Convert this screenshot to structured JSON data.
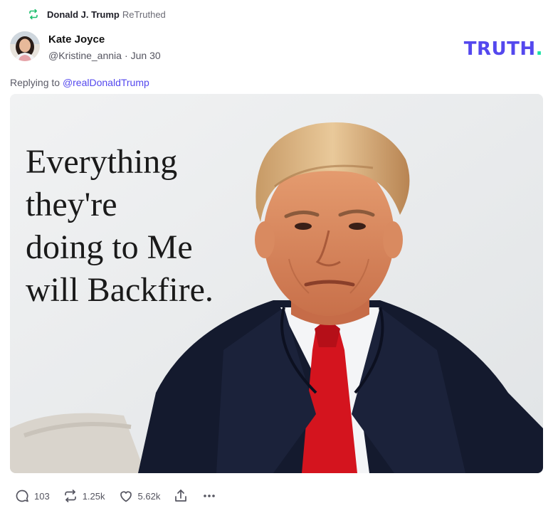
{
  "retruth": {
    "user": "Donald J. Trump",
    "label": "ReTruthed"
  },
  "author": {
    "name": "Kate Joyce",
    "handle": "@Kristine_annia",
    "date": "Jun 30"
  },
  "logo": {
    "text": "TRUTH",
    "dot": "."
  },
  "reply": {
    "prefix": "Replying to",
    "handle": "@realDonaldTrump"
  },
  "media": {
    "quote_lines": [
      "Everything",
      "they're",
      "doing to Me",
      "will Backfire."
    ]
  },
  "actions": {
    "replies": "103",
    "retruths": "1.25k",
    "likes": "5.62k"
  },
  "colors": {
    "brand": "#5448ee",
    "accent": "#17e3a5",
    "retruth_green": "#1fbf6f"
  }
}
